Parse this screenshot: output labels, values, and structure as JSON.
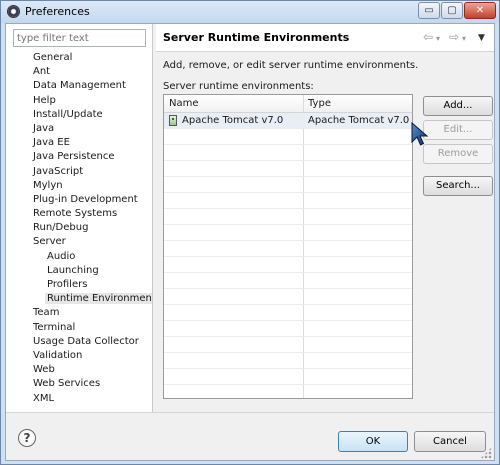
{
  "window": {
    "title": "Preferences",
    "minimize_glyph": "▭",
    "maximize_glyph": "▢",
    "close_glyph": "✕"
  },
  "filter": {
    "placeholder": "type filter text"
  },
  "tree": {
    "items": [
      {
        "label": "General",
        "level": 0
      },
      {
        "label": "Ant",
        "level": 0
      },
      {
        "label": "Data Management",
        "level": 0
      },
      {
        "label": "Help",
        "level": 0
      },
      {
        "label": "Install/Update",
        "level": 0
      },
      {
        "label": "Java",
        "level": 0
      },
      {
        "label": "Java EE",
        "level": 0
      },
      {
        "label": "Java Persistence",
        "level": 0
      },
      {
        "label": "JavaScript",
        "level": 0
      },
      {
        "label": "Mylyn",
        "level": 0
      },
      {
        "label": "Plug-in Development",
        "level": 0
      },
      {
        "label": "Remote Systems",
        "level": 0
      },
      {
        "label": "Run/Debug",
        "level": 0
      },
      {
        "label": "Server",
        "level": 0
      },
      {
        "label": "Audio",
        "level": 1
      },
      {
        "label": "Launching",
        "level": 1
      },
      {
        "label": "Profilers",
        "level": 1
      },
      {
        "label": "Runtime Environments",
        "level": 1,
        "selected": true
      },
      {
        "label": "Team",
        "level": 0
      },
      {
        "label": "Terminal",
        "level": 0
      },
      {
        "label": "Usage Data Collector",
        "level": 0
      },
      {
        "label": "Validation",
        "level": 0
      },
      {
        "label": "Web",
        "level": 0
      },
      {
        "label": "Web Services",
        "level": 0
      },
      {
        "label": "XML",
        "level": 0
      }
    ]
  },
  "page": {
    "title": "Server Runtime Environments",
    "nav": {
      "back": "⇦",
      "forward": "⇨",
      "dropdown": "▾",
      "menu": "▼"
    },
    "description": "Add, remove, or edit server runtime environments.",
    "list_label": "Server runtime environments:",
    "table": {
      "columns": [
        "Name",
        "Type"
      ],
      "rows": [
        {
          "name": "Apache Tomcat v7.0",
          "type": "Apache Tomcat v7.0",
          "selected": true
        }
      ],
      "empty_rows": 16
    },
    "buttons": {
      "add": "Add...",
      "edit": "Edit...",
      "remove": "Remove",
      "search": "Search..."
    }
  },
  "footer": {
    "help": "?",
    "ok": "OK",
    "cancel": "Cancel"
  }
}
